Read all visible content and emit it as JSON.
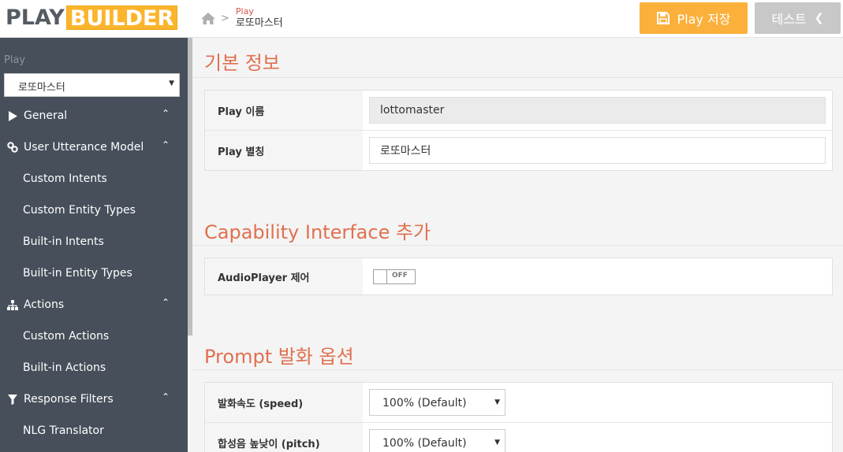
{
  "brand": {
    "logo_left": "PLAY",
    "logo_right": "BUILDER"
  },
  "breadcrumb": {
    "parent": "Play",
    "current": "로또마스터"
  },
  "toolbar": {
    "save_label": "Play 저장",
    "test_label": "테스트"
  },
  "sidebar": {
    "select_label": "Play",
    "selected_play": "로또마스터",
    "items": [
      {
        "label": "General",
        "icon": "play-icon",
        "type": "group"
      },
      {
        "label": "User Utterance Model",
        "icon": "link-icon",
        "type": "group"
      },
      {
        "label": "Custom Intents",
        "type": "sub"
      },
      {
        "label": "Custom Entity Types",
        "type": "sub"
      },
      {
        "label": "Built-in Intents",
        "type": "sub"
      },
      {
        "label": "Built-in Entity Types",
        "type": "sub"
      },
      {
        "label": "Actions",
        "icon": "sitemap-icon",
        "type": "group"
      },
      {
        "label": "Custom Actions",
        "type": "sub"
      },
      {
        "label": "Built-in Actions",
        "type": "sub"
      },
      {
        "label": "Response Filters",
        "icon": "filter-icon",
        "type": "group"
      },
      {
        "label": "NLG Translator",
        "type": "sub"
      }
    ]
  },
  "basic_info": {
    "title": "기본 정보",
    "name_label": "Play 이름",
    "name_value": "lottomaster",
    "alias_label": "Play 별칭",
    "alias_value": "로또마스터"
  },
  "capability": {
    "title": "Capability Interface 추가",
    "audio_label": "AudioPlayer 제어",
    "audio_state": "OFF"
  },
  "prompt": {
    "title": "Prompt 발화 옵션",
    "speed_label": "발화속도 (speed)",
    "speed_value": "100% (Default)",
    "pitch_label": "합성음 높낮이 (pitch)",
    "pitch_value": "100% (Default)"
  },
  "colors": {
    "accent": "#fbb03b",
    "section_title": "#e0704f",
    "sidebar_bg": "#464f5a"
  }
}
